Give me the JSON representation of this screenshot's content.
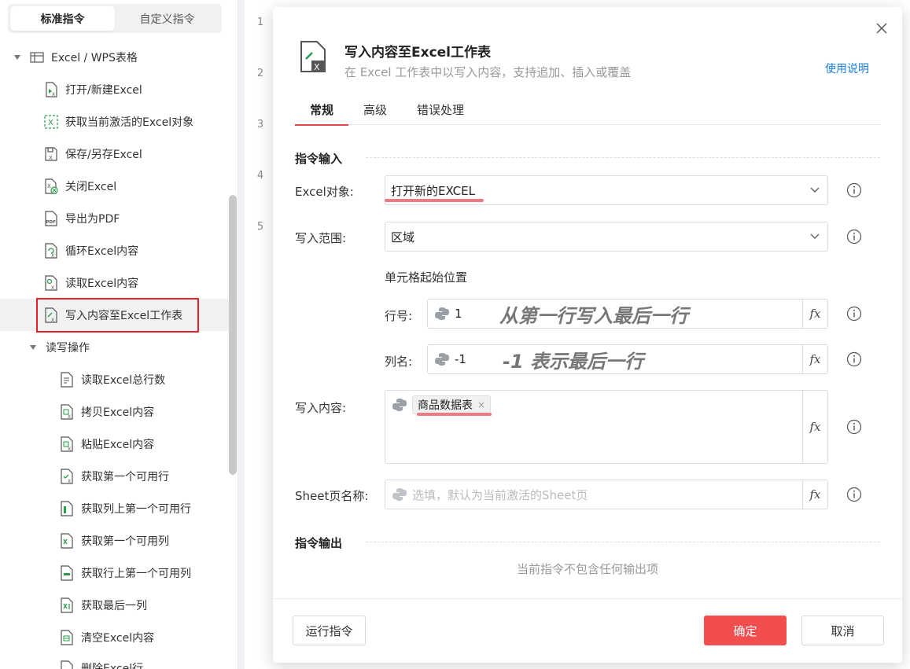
{
  "sidebar": {
    "tabs": [
      {
        "label": "标准指令"
      },
      {
        "label": "自定义指令"
      }
    ],
    "group": {
      "label": "Excel / WPS表格"
    },
    "items": [
      {
        "label": "打开/新建Excel"
      },
      {
        "label": "获取当前激活的Excel对象"
      },
      {
        "label": "保存/另存Excel"
      },
      {
        "label": "关闭Excel"
      },
      {
        "label": "导出为PDF"
      },
      {
        "label": "循环Excel内容"
      },
      {
        "label": "读取Excel内容"
      },
      {
        "label": "写入内容至Excel工作表"
      }
    ],
    "subgroup": {
      "label": "读写操作"
    },
    "subitems": [
      {
        "label": "读取Excel总行数"
      },
      {
        "label": "拷贝Excel内容"
      },
      {
        "label": "粘贴Excel内容"
      },
      {
        "label": "获取第一个可用行"
      },
      {
        "label": "获取列上第一个可用行"
      },
      {
        "label": "获取第一个可用列"
      },
      {
        "label": "获取行上第一个可用列"
      },
      {
        "label": "获取最后一列"
      },
      {
        "label": "清空Excel内容"
      },
      {
        "label": "删除Excel行"
      }
    ]
  },
  "editor": {
    "line_numbers": [
      "1",
      "2",
      "3",
      "4",
      "5"
    ]
  },
  "modal": {
    "title": "写入内容至Excel工作表",
    "description": "在 Excel 工作表中以写入内容，支持追加、插入或覆盖",
    "help_link": "使用说明",
    "tabs": [
      {
        "label": "常规"
      },
      {
        "label": "高级"
      },
      {
        "label": "错误处理"
      }
    ],
    "input_section": "指令输入",
    "fields": {
      "excel_object": {
        "label": "Excel对象:",
        "value": "打开新的EXCEL"
      },
      "write_range": {
        "label": "写入范围:",
        "value": "区域"
      },
      "cell_start_label": "单元格起始位置",
      "row": {
        "label": "行号:",
        "value": "1",
        "note": "从第一行写入最后一行"
      },
      "col": {
        "label": "列名:",
        "value": "-1",
        "note": "-1 表示最后一行"
      },
      "content": {
        "label": "写入内容:",
        "tag": "商品数据表"
      },
      "sheet": {
        "label": "Sheet页名称:",
        "placeholder": "选填，默认为当前激活的Sheet页"
      }
    },
    "output_section": "指令输出",
    "no_output": "当前指令不包含任何输出项",
    "buttons": {
      "run": "运行指令",
      "ok": "确定",
      "cancel": "取消"
    },
    "fx_label": "fx",
    "tag_close": "×"
  },
  "colors": {
    "accent": "#f24d4f",
    "link": "#1a7fe0",
    "highlight_box": "#e5202b",
    "underline": "#f07a82"
  }
}
